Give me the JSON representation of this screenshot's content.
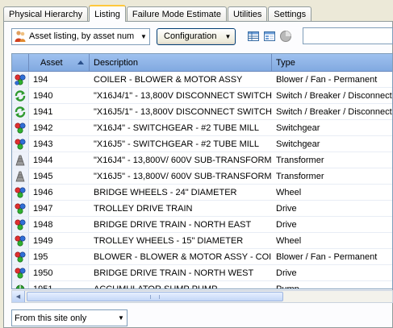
{
  "tabs": [
    "Physical Hierarchy",
    "Listing",
    "Failure Mode Estimate",
    "Utilities",
    "Settings"
  ],
  "active_tab": 1,
  "toolbar": {
    "view_select": "Asset listing, by asset num",
    "configuration_label": "Configuration"
  },
  "grid": {
    "columns": [
      "Asset",
      "Description",
      "Type"
    ],
    "sort_column": "Asset",
    "rows": [
      {
        "icon": "blower",
        "asset": "194",
        "description": "COILER - BLOWER & MOTOR ASSY",
        "type": "Blower / Fan - Permanent"
      },
      {
        "icon": "switch",
        "asset": "1940",
        "description": "\"X16J4/1\" - 13,800V DISCONNECT SWITCH...",
        "type": "Switch / Breaker / Disconnect"
      },
      {
        "icon": "switch",
        "asset": "1941",
        "description": "\"X16J5/1\" - 13,800V DISCONNECT SWITCH...",
        "type": "Switch / Breaker / Disconnect"
      },
      {
        "icon": "component",
        "asset": "1942",
        "description": "\"X16J4\" - SWITCHGEAR - #2 TUBE MILL",
        "type": "Switchgear"
      },
      {
        "icon": "component",
        "asset": "1943",
        "description": "\"X16J5\" - SWITCHGEAR - #2 TUBE MILL",
        "type": "Switchgear"
      },
      {
        "icon": "transformer",
        "asset": "1944",
        "description": "\"X16J4\" - 13,800V/ 600V SUB-TRANSFORM...",
        "type": "Transformer"
      },
      {
        "icon": "transformer",
        "asset": "1945",
        "description": "\"X16J5\" - 13,800V/ 600V SUB-TRANSFORM...",
        "type": "Transformer"
      },
      {
        "icon": "component",
        "asset": "1946",
        "description": "BRIDGE WHEELS - 24\" DIAMETER",
        "type": "Wheel"
      },
      {
        "icon": "component",
        "asset": "1947",
        "description": "TROLLEY DRIVE TRAIN",
        "type": "Drive"
      },
      {
        "icon": "component",
        "asset": "1948",
        "description": "BRIDGE DRIVE TRAIN - NORTH EAST",
        "type": "Drive"
      },
      {
        "icon": "component",
        "asset": "1949",
        "description": "TROLLEY WHEELS - 15\" DIAMETER",
        "type": "Wheel"
      },
      {
        "icon": "component",
        "asset": "195",
        "description": "BLOWER - BLOWER & MOTOR ASSY - COILER",
        "type": "Blower / Fan - Permanent"
      },
      {
        "icon": "component",
        "asset": "1950",
        "description": "BRIDGE DRIVE TRAIN - NORTH WEST",
        "type": "Drive"
      },
      {
        "icon": "pump",
        "asset": "1951",
        "description": "ACCUMULATOR SUMP PUMP",
        "type": "Pump"
      }
    ]
  },
  "site_filter": "From this site only"
}
